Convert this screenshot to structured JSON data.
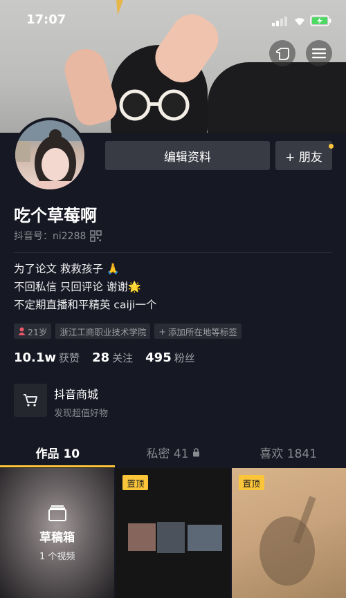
{
  "status_bar": {
    "time": "17:07"
  },
  "profile": {
    "edit_label": "编辑资料",
    "friend_label": "+ 朋友",
    "name": "吃个草莓啊",
    "douyin_id": "抖音号：ni2288",
    "bio": [
      "为了论文 救救孩子 🙏",
      "不回私信 只回评论 谢谢🌟",
      "不定期直播和平精英 caiji一个"
    ],
    "tags": {
      "age": "21岁",
      "school": "浙江工商职业技术学院",
      "add": "添加所在地等标签"
    }
  },
  "stats": {
    "likes_num": "10.1w",
    "likes_label": "获赞",
    "following_num": "28",
    "following_label": "关注",
    "followers_num": "495",
    "followers_label": "粉丝"
  },
  "shop": {
    "title": "抖音商城",
    "subtitle": "发现超值好物"
  },
  "tabs": {
    "works": "作品 10",
    "private": "私密 41",
    "likes": "喜欢 1841"
  },
  "grid": {
    "draft_title": "草稿箱",
    "draft_sub": "1 个视频",
    "pinned": "置顶"
  },
  "colors": {
    "accent": "#fbc53a",
    "background": "#161823",
    "button": "#393b44"
  }
}
